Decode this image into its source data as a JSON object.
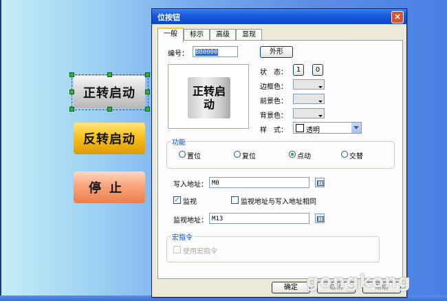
{
  "canvas": {
    "buttons": [
      {
        "label": "正转启动",
        "selected": true
      },
      {
        "label": "反转启动",
        "selected": false
      },
      {
        "label": "停止",
        "selected": false
      }
    ]
  },
  "dialog": {
    "title": "位按钮",
    "close_glyph": "×",
    "tabs": [
      {
        "label": "一般",
        "active": true
      },
      {
        "label": "标示",
        "active": false
      },
      {
        "label": "高级",
        "active": false
      },
      {
        "label": "显现",
        "active": false
      }
    ],
    "general": {
      "id_label": "编号：",
      "id_value": "BB0000",
      "shape_button": "外形",
      "preview_text": "正转启动",
      "state_label": "状　态：",
      "state_options": [
        "1",
        "0"
      ],
      "border_color_label": "边框色：",
      "foreground_label": "前景色：",
      "background_label": "背景色：",
      "style_label": "样　式：",
      "style_value": "透明",
      "function_group": "功能",
      "functions": [
        {
          "label": "置位",
          "checked": false
        },
        {
          "label": "复位",
          "checked": false
        },
        {
          "label": "点动",
          "checked": true
        },
        {
          "label": "交替",
          "checked": false
        }
      ],
      "write_addr_label": "写入地址：",
      "write_addr_value": "M0",
      "monitor_label": "监视",
      "monitor_checked": true,
      "same_addr_label": "监视地址与写入地址相同",
      "same_addr_checked": false,
      "monitor_addr_label": "监视地址：",
      "monitor_addr_value": "M13",
      "macro_group": "宏指令",
      "use_macro_label": "使用宏指令",
      "use_macro_checked": false
    },
    "footer": {
      "ok": "确定",
      "cancel": "取消",
      "help": "帮助"
    }
  },
  "watermark": "gongkong",
  "colors": {
    "title_bar": "#1a5ce0",
    "group_title": "#0046d5",
    "radio_dot": "#21a121"
  }
}
